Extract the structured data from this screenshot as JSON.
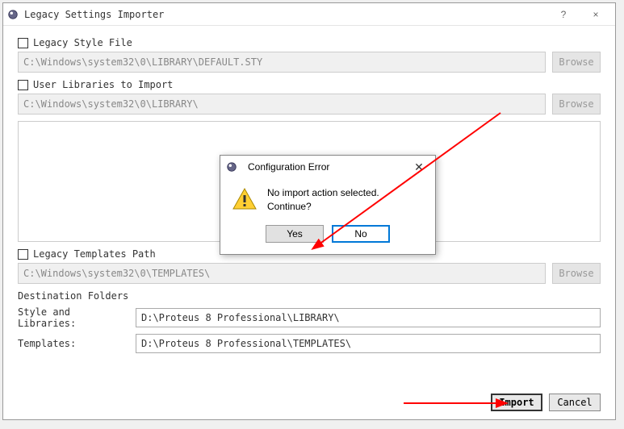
{
  "window": {
    "title": "Legacy Settings Importer",
    "help": "?",
    "close": "×"
  },
  "section1": {
    "label": "Legacy Style File",
    "path": "C:\\Windows\\system32\\0\\LIBRARY\\DEFAULT.STY",
    "browse": "Browse"
  },
  "section2": {
    "label": "User Libraries to Import",
    "path": "C:\\Windows\\system32\\0\\LIBRARY\\",
    "browse": "Browse"
  },
  "section3": {
    "label": "Legacy Templates Path",
    "path": "C:\\Windows\\system32\\0\\TEMPLATES\\",
    "browse": "Browse"
  },
  "dest": {
    "header": "Destination Folders",
    "styleLabel": "Style and Libraries:",
    "styleValue": "D:\\Proteus 8 Professional\\LIBRARY\\",
    "tmplLabel": "Templates:",
    "tmplValue": "D:\\Proteus 8 Professional\\TEMPLATES\\"
  },
  "buttons": {
    "import": "Import",
    "cancel": "Cancel"
  },
  "modal": {
    "title": "Configuration Error",
    "line1": "No import action selected.",
    "line2": "Continue?",
    "yes": "Yes",
    "no": "No"
  }
}
